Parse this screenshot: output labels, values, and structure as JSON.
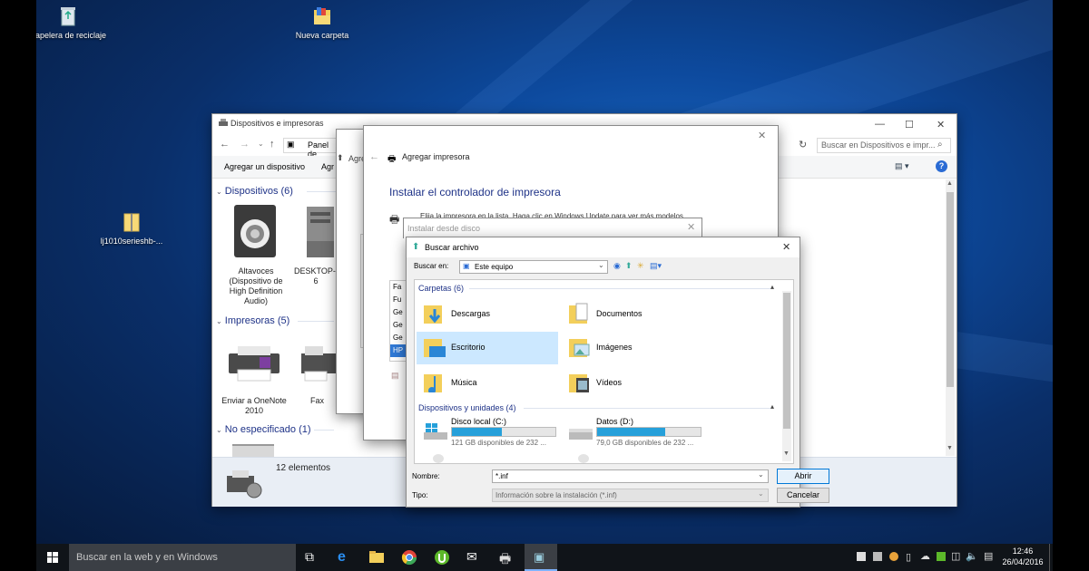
{
  "desktop": {
    "icons": [
      {
        "label": "Papelera de reciclaje",
        "icon": "recycle-bin-icon"
      },
      {
        "label": "Nueva carpeta",
        "icon": "folder-icon"
      },
      {
        "label": "lj1010serieshb-...",
        "icon": "zip-folder-icon"
      }
    ]
  },
  "devices_window": {
    "title": "Dispositivos e impresoras",
    "address": "Panel de",
    "search_placeholder": "Buscar en Dispositivos e impr...",
    "toolbar": {
      "add_device": "Agregar un dispositivo",
      "add_printer_partial": "Agr"
    },
    "sections": [
      {
        "label": "Dispositivos (6)"
      },
      {
        "label": "Impresoras (5)"
      },
      {
        "label": "No especificado (1)"
      }
    ],
    "devices": [
      {
        "label": "Altavoces (Dispositivo de High Definition Audio)"
      },
      {
        "label": "DESKTOP-... 6"
      }
    ],
    "printers": [
      {
        "label": "Enviar a OneNote 2010"
      },
      {
        "label": "Fax"
      }
    ],
    "status": "12 elementos",
    "help": "?"
  },
  "wizard_back": {
    "title_partial": "Agre"
  },
  "wizard": {
    "title": "Agregar impresora",
    "heading": "Instalar el controlador de impresora",
    "instruction": "Elija la impresora en la lista. Haga clic en Windows Update para ver más modelos.",
    "list_items": [
      "Fa",
      "Fu",
      "Ge",
      "Ge",
      "Ge",
      "HP"
    ]
  },
  "install_disk": {
    "title": "Instalar desde disco"
  },
  "browse": {
    "title": "Buscar archivo",
    "look_in_label": "Buscar en:",
    "look_in_value": "Este equipo",
    "folders_header": "Carpetas (6)",
    "folders": [
      {
        "label": "Descargas",
        "icon": "downloads-folder-icon"
      },
      {
        "label": "Documentos",
        "icon": "documents-folder-icon"
      },
      {
        "label": "Escritorio",
        "icon": "desktop-folder-icon"
      },
      {
        "label": "Imágenes",
        "icon": "pictures-folder-icon"
      },
      {
        "label": "Música",
        "icon": "music-folder-icon"
      },
      {
        "label": "Vídeos",
        "icon": "videos-folder-icon"
      }
    ],
    "drives_header": "Dispositivos y unidades (4)",
    "drives": [
      {
        "label": "Disco local (C:)",
        "free": "121 GB disponibles de 232 ...",
        "used_fraction": 0.48
      },
      {
        "label": "Datos (D:)",
        "free": "79,0 GB disponibles de 232 ...",
        "used_fraction": 0.66
      }
    ],
    "name_label": "Nombre:",
    "name_value": "*.inf",
    "type_label": "Tipo:",
    "type_value": "Información sobre la instalación (*.inf)",
    "open_button": "Abrir",
    "cancel_button": "Cancelar"
  },
  "taskbar": {
    "search_placeholder": "Buscar en la web y en Windows",
    "time": "12:46",
    "date": "26/04/2016"
  },
  "colors": {
    "accent": "#26a0da",
    "selection": "#cce8ff",
    "taskbar": "#101419",
    "section_text": "#1e3287"
  }
}
